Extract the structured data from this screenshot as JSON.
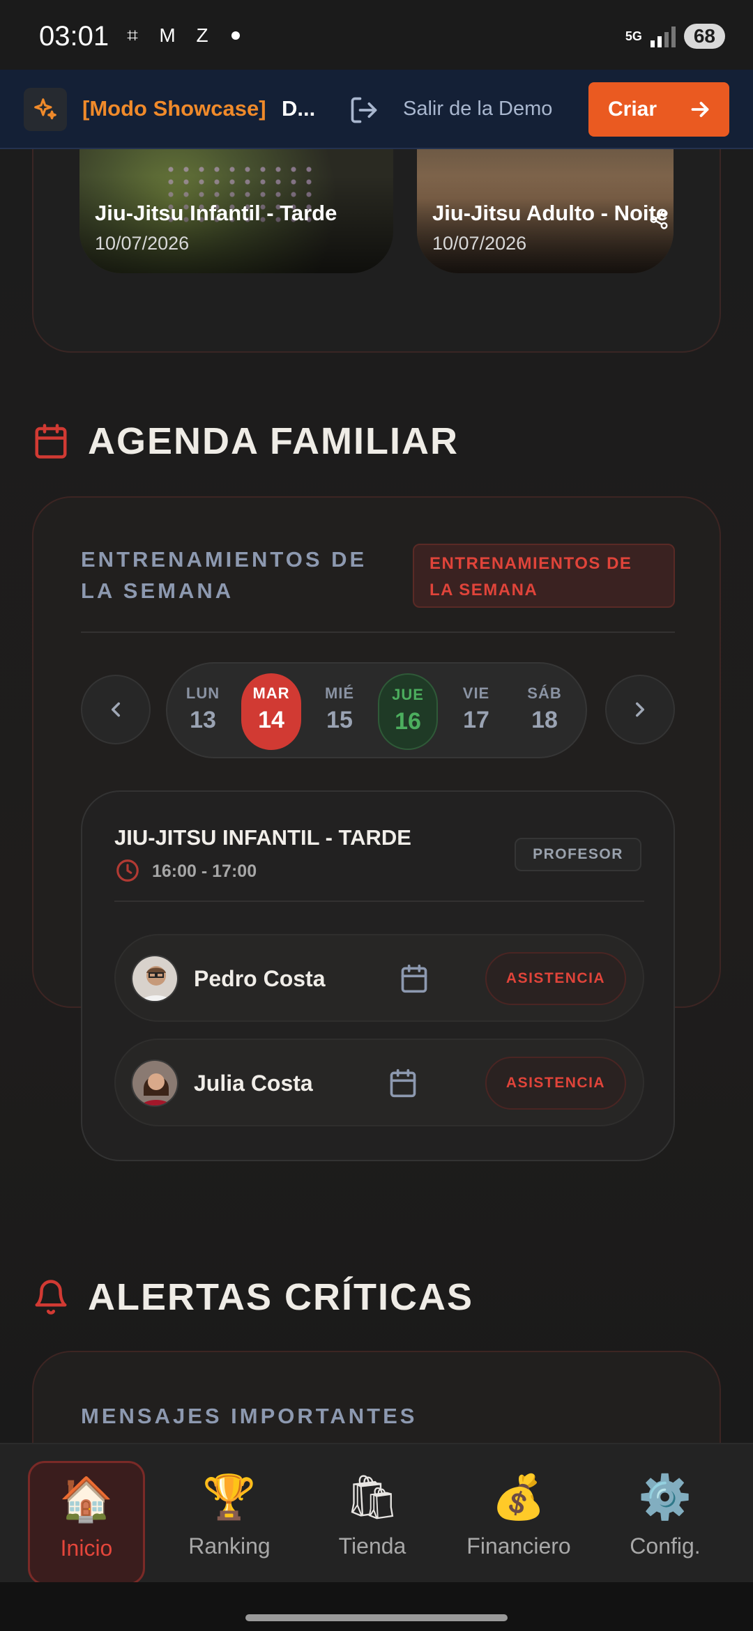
{
  "status_bar": {
    "time": "03:01",
    "network": "5G",
    "battery": "68"
  },
  "demo_banner": {
    "mode_label": "[Modo Showcase]",
    "mode_suffix": "D...",
    "exit_label": "Salir de la Demo",
    "create_label": "Criar"
  },
  "carousel": [
    {
      "title": "Jiu-Jitsu Infantil - Tarde",
      "date": "10/07/2026"
    },
    {
      "title": "Jiu-Jitsu Adulto - Noite",
      "date": "10/07/2026"
    }
  ],
  "agenda": {
    "section_title": "AGENDA FAMILIAR",
    "heading": "ENTRENAMIENTOS DE LA SEMANA",
    "badge": "ENTRENAMIENTOS DE LA SEMANA",
    "days": [
      {
        "name": "LUN",
        "num": "13"
      },
      {
        "name": "MAR",
        "num": "14"
      },
      {
        "name": "MIÉ",
        "num": "15"
      },
      {
        "name": "JUE",
        "num": "16"
      },
      {
        "name": "VIE",
        "num": "17"
      },
      {
        "name": "SÁB",
        "num": "18"
      }
    ],
    "selected_day": "MAR",
    "today": "JUE",
    "class": {
      "title": "JIU-JITSU INFANTIL - TARDE",
      "time": "16:00 - 17:00",
      "role_badge": "PROFESOR",
      "students": [
        {
          "name": "Pedro Costa",
          "action": "ASISTENCIA"
        },
        {
          "name": "Julia Costa",
          "action": "ASISTENCIA"
        }
      ]
    }
  },
  "alerts": {
    "section_title": "ALERTAS CRÍTICAS",
    "subheading": "MENSAJES IMPORTANTES"
  },
  "bottom_nav": [
    {
      "label": "Inicio",
      "icon": "house-icon",
      "active": true
    },
    {
      "label": "Ranking",
      "icon": "trophy-icon",
      "active": false
    },
    {
      "label": "Tienda",
      "icon": "shopping-bags-icon",
      "active": false
    },
    {
      "label": "Financiero",
      "icon": "money-bag-icon",
      "active": false
    },
    {
      "label": "Config.",
      "icon": "gear-icon",
      "active": false
    }
  ],
  "colors": {
    "accent": "#d13a33",
    "brand_orange": "#ea5a21",
    "today_green": "#4cae5e"
  }
}
